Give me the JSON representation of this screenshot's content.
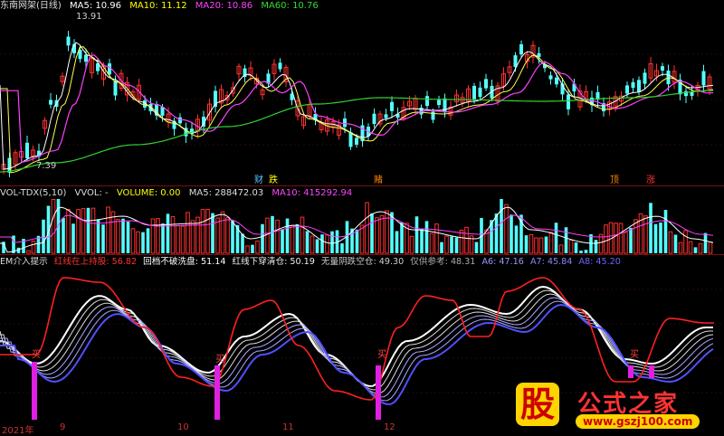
{
  "price_header": {
    "title": "东南网架(日线)",
    "ma5": "MA5: 10.96",
    "ma10": "MA10: 11.12",
    "ma20": "MA20: 10.86",
    "ma60": "MA60: 10.76"
  },
  "price_labels": {
    "high": "13.91",
    "low": "7.39"
  },
  "signal_tags": [
    "财",
    "跌",
    "赌",
    "顶",
    "涨"
  ],
  "vol_header": {
    "name": "VOL-TDX(5,10)",
    "vvol": "VVOL: -",
    "volume": "VOLUME: 0.00",
    "ma5": "MA5: 288472.03",
    "ma10": "MA10: 415292.94"
  },
  "em_header": {
    "name": "EM介入提示",
    "red_line": "红线在上持股: 56.82",
    "pullback": "回档不破洗盘: 51.14",
    "red_down": "红线下穿清仓: 50.19",
    "no_bull": "无量阴跌空仓: 49.30",
    "ref": "仅供参考: 48.31",
    "a6": "A6: 47.16",
    "a7": "A7: 45.84",
    "a8": "A8: 45.20"
  },
  "em_markers": [
    "买",
    "买",
    "买",
    "买"
  ],
  "axis_labels": [
    "2021年",
    "9",
    "10",
    "11",
    "12"
  ],
  "watermark": {
    "logo": "股",
    "site_cn": "公式之家",
    "url": "www.gszj100.com"
  },
  "colors": {
    "up": "#ff3030",
    "down": "#54ffff",
    "ma5": "#ffffff",
    "ma10": "#ffff50",
    "ma20": "#ff40ff",
    "ma60": "#30d030",
    "em_red": "#ff2020",
    "em_blue": "#5050ff"
  }
}
